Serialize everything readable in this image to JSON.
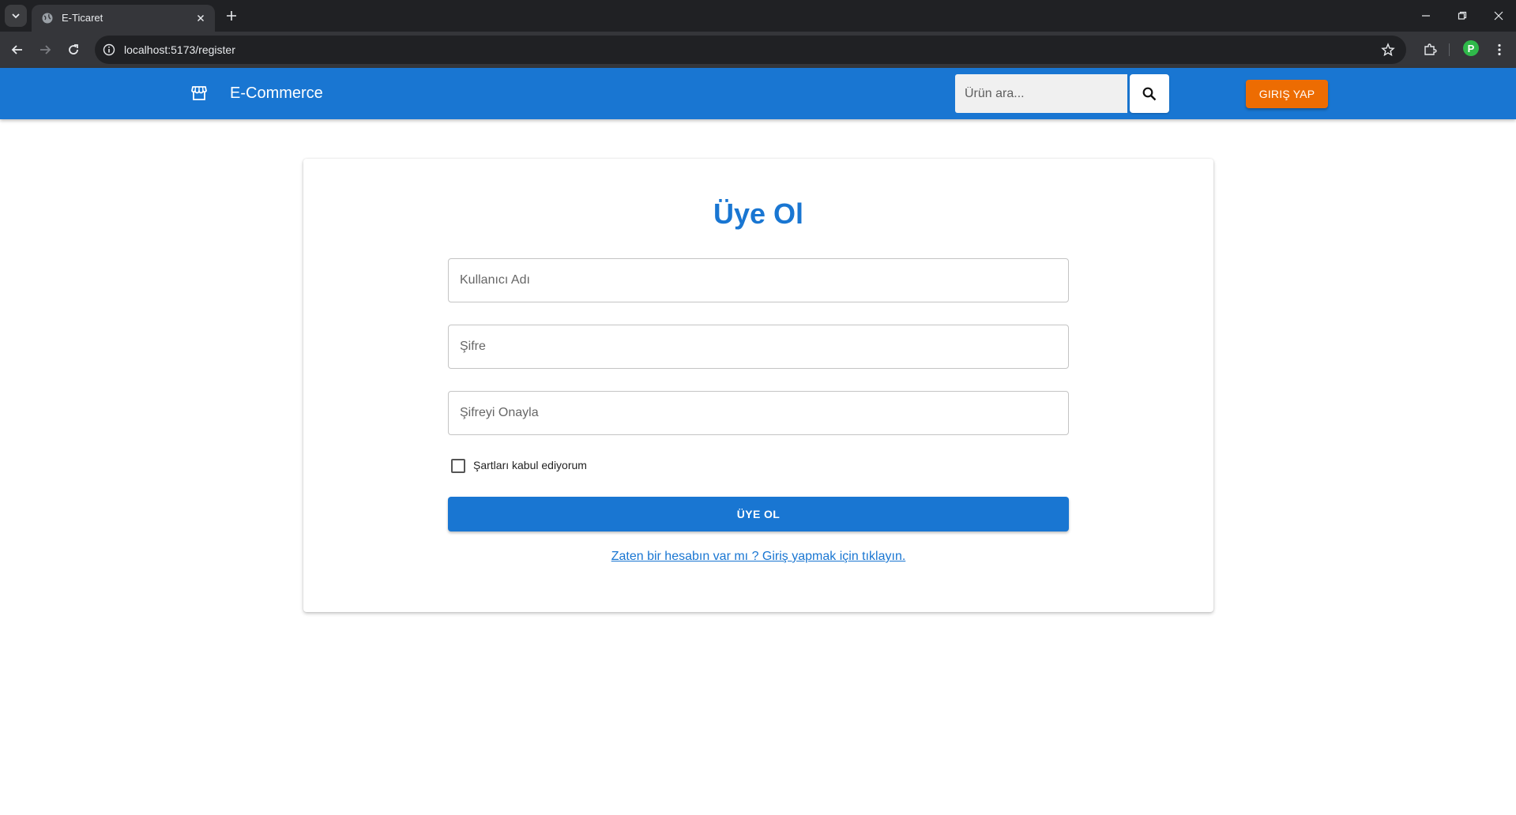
{
  "browser": {
    "tab_title": "E-Ticaret",
    "url": "localhost:5173/register",
    "profile_initial": "P"
  },
  "header": {
    "brand": "E-Commerce",
    "search_placeholder": "Ürün ara...",
    "login_label": "GIRIŞ YAP",
    "brand_color": "#1976d2",
    "login_color": "#ed6c02"
  },
  "form": {
    "title": "Üye Ol",
    "username_placeholder": "Kullanıcı Adı",
    "password_placeholder": "Şifre",
    "confirm_placeholder": "Şifreyi Onayla",
    "terms_label": "Şartları kabul ediyorum",
    "terms_checked": false,
    "submit_label": "ÜYE OL",
    "login_link": "Zaten bir hesabın var mı ? Giriş yapmak için tıklayın."
  }
}
